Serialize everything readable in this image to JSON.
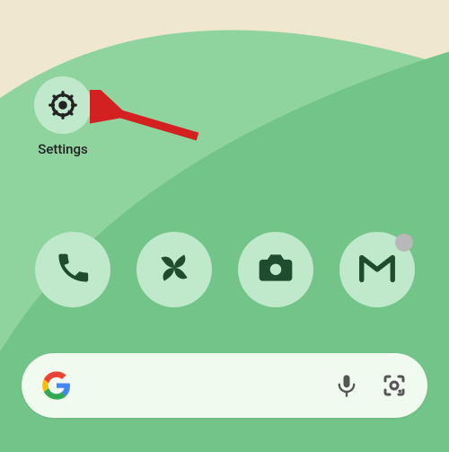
{
  "settings": {
    "label": "Settings",
    "icon": "gear-icon"
  },
  "dock": [
    {
      "name": "phone",
      "icon": "phone-icon",
      "badge": false
    },
    {
      "name": "photos",
      "icon": "pinwheel-icon",
      "badge": false
    },
    {
      "name": "camera",
      "icon": "camera-icon",
      "badge": false
    },
    {
      "name": "gmail",
      "icon": "gmail-m-icon",
      "badge": true
    }
  ],
  "search": {
    "provider": "Google",
    "placeholder": ""
  },
  "annotation": {
    "arrow_color": "#d32020",
    "target": "settings-app"
  },
  "colors": {
    "icon_bg": "#c0e8ca",
    "icon_fg": "#1f4c2e",
    "search_bg": "#f1faef",
    "wall_green_light": "#8fd49f",
    "wall_green": "#73c489",
    "wall_sky": "#efe7ce"
  }
}
